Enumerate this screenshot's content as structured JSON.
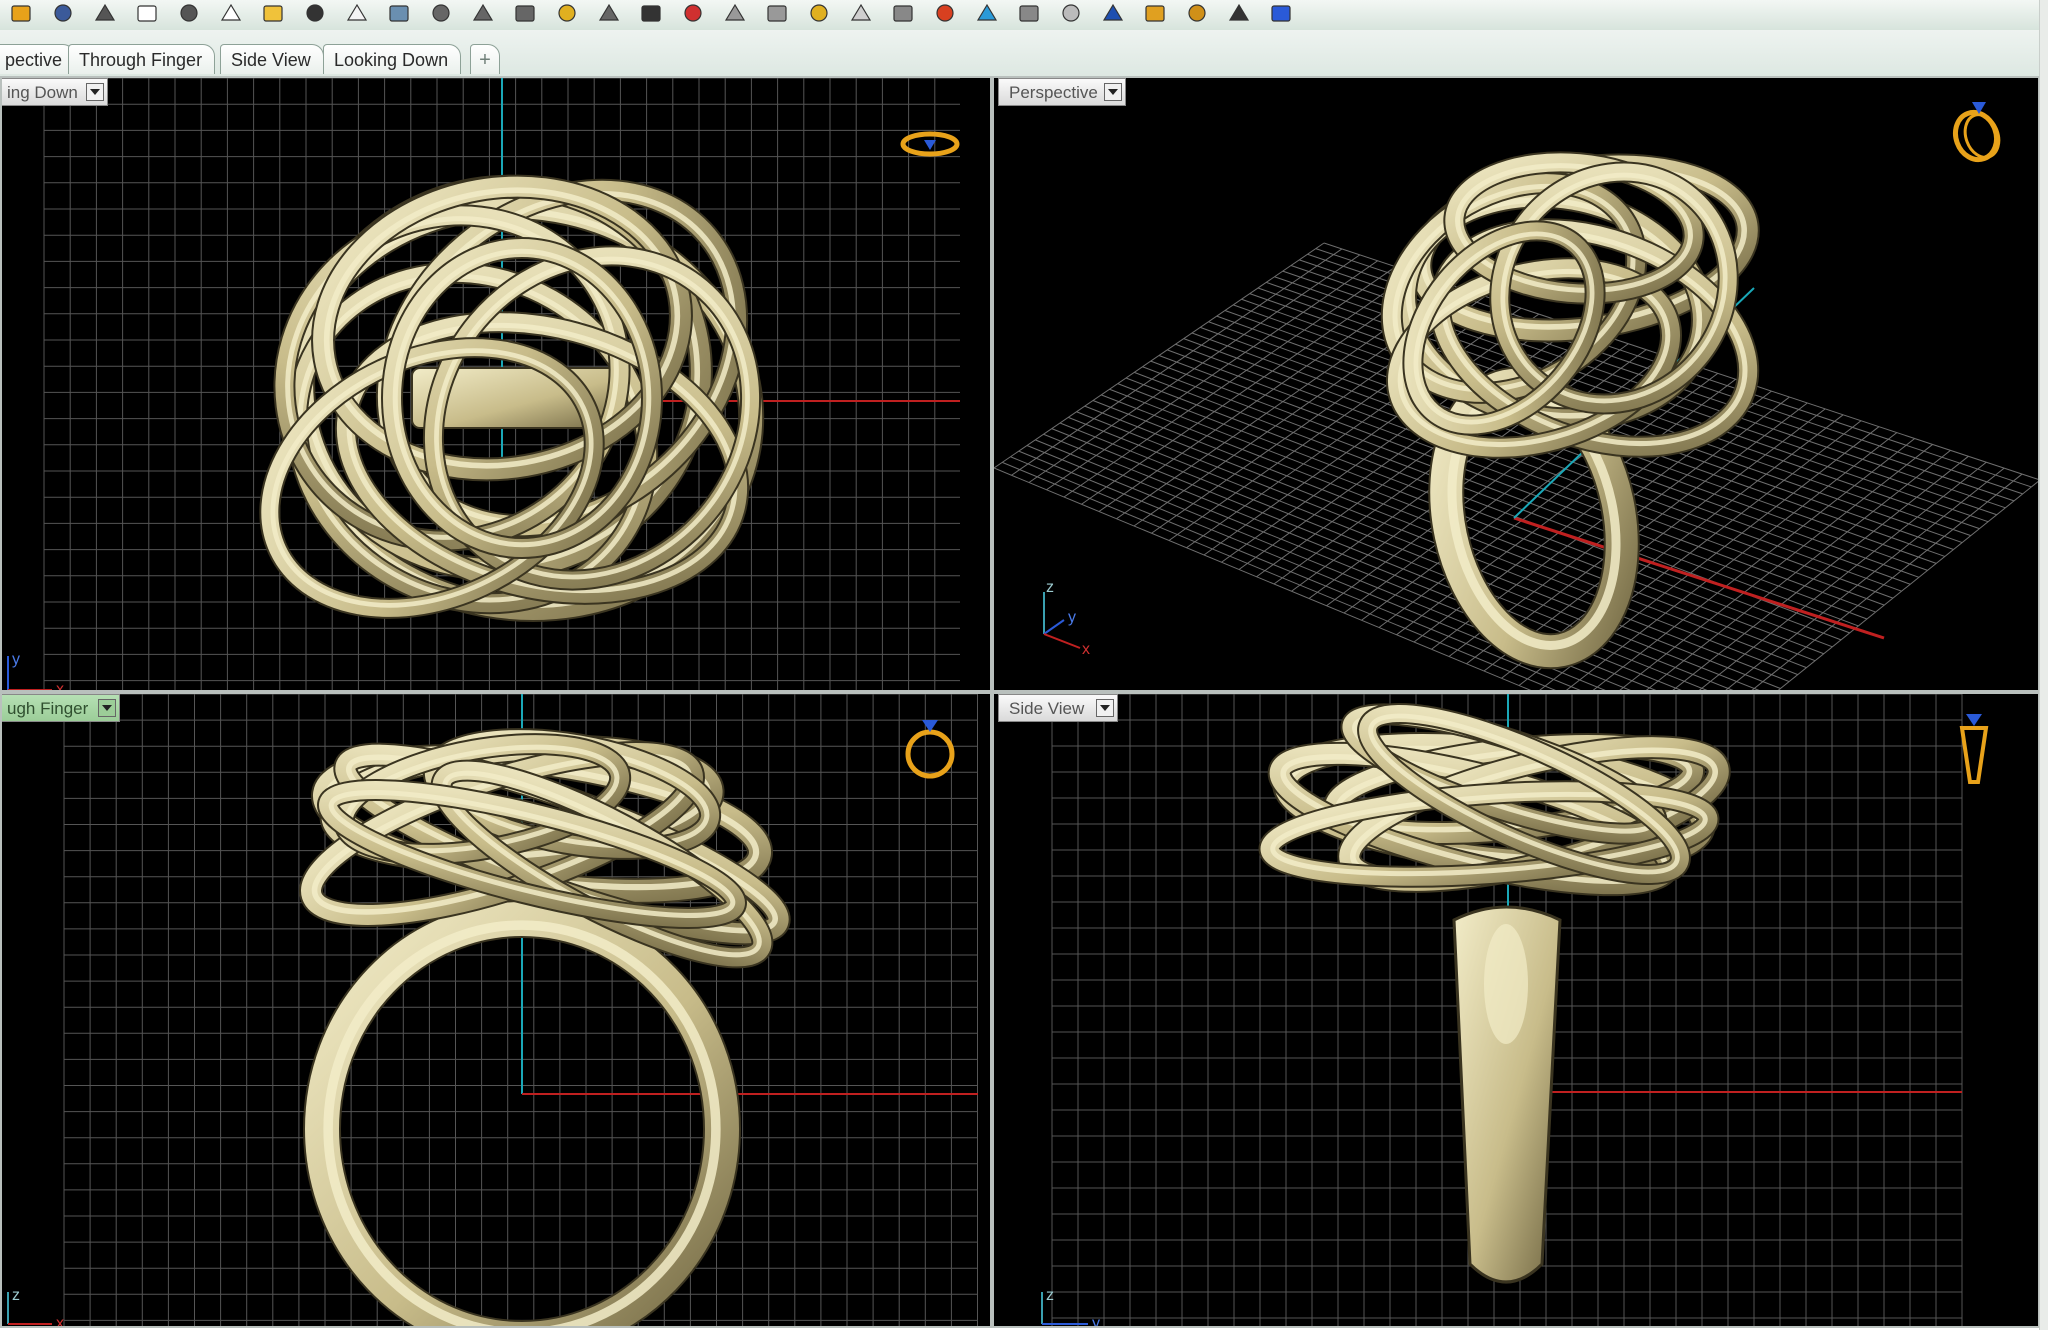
{
  "toolbar": {
    "buttons": [
      {
        "name": "open-icon",
        "color": "#e8a21a"
      },
      {
        "name": "save-icon",
        "color": "#3b5a9a"
      },
      {
        "name": "print-icon",
        "color": "#555555"
      },
      {
        "name": "new-page-icon",
        "color": "#ffffff"
      },
      {
        "name": "cut-icon",
        "color": "#555555"
      },
      {
        "name": "copy-icon",
        "color": "#ffffff"
      },
      {
        "name": "paste-icon",
        "color": "#f0c23a"
      },
      {
        "name": "undo-icon",
        "color": "#333333"
      },
      {
        "name": "pan-hand-icon",
        "color": "#f4f4f4"
      },
      {
        "name": "rotate-view-icon",
        "color": "#6a8fb0"
      },
      {
        "name": "zoom-dynamic-icon",
        "color": "#666666"
      },
      {
        "name": "zoom-window-icon",
        "color": "#666666"
      },
      {
        "name": "zoom-extents-icon",
        "color": "#666666"
      },
      {
        "name": "zoom-selected-icon",
        "color": "#e0b020"
      },
      {
        "name": "zoom-target-icon",
        "color": "#666666"
      },
      {
        "name": "four-viewports-icon",
        "color": "#333333"
      },
      {
        "name": "car-icon",
        "color": "#d03030"
      },
      {
        "name": "construction-plane-icon",
        "color": "#999999"
      },
      {
        "name": "circle-snap-icon",
        "color": "#999999"
      },
      {
        "name": "points-icon",
        "color": "#e0b020"
      },
      {
        "name": "lightbulb-icon",
        "color": "#cfcfcf"
      },
      {
        "name": "lock-icon",
        "color": "#888888"
      },
      {
        "name": "layers-icon",
        "color": "#d84020"
      },
      {
        "name": "color-wheel-icon",
        "color": "#2a9ad8"
      },
      {
        "name": "wireframe-sphere-icon",
        "color": "#888888"
      },
      {
        "name": "shaded-sphere-icon",
        "color": "#bbbbbb"
      },
      {
        "name": "render-sphere-icon",
        "color": "#1e4fb0"
      },
      {
        "name": "pencil-icon",
        "color": "#e0a020"
      },
      {
        "name": "settings-gear-icon",
        "color": "#d09018"
      },
      {
        "name": "grid-snap-icon",
        "color": "#333333"
      },
      {
        "name": "help-icon",
        "color": "#2a5ad8"
      }
    ]
  },
  "tabs": [
    {
      "label": "pective",
      "active": false
    },
    {
      "label": "Through Finger",
      "active": true
    },
    {
      "label": "Side View",
      "active": false
    },
    {
      "label": "Looking Down",
      "active": false
    }
  ],
  "tab_add_label": "+",
  "viewports": {
    "top_left": {
      "label": "ing Down",
      "gumball": "flat-ring-icon"
    },
    "top_right": {
      "label": "Perspective",
      "gumball": "perspective-ring-icon"
    },
    "bottom_left": {
      "label": "ugh Finger",
      "gumball": "front-ring-icon"
    },
    "bottom_right": {
      "label": "Side View",
      "gumball": "side-ring-icon"
    }
  },
  "axes": {
    "top_left": {
      "v": "y",
      "h": "x"
    },
    "top_right": {
      "v": "z",
      "d": "y",
      "h": "x"
    },
    "bottom_left": {
      "v": "z",
      "h": "x"
    },
    "bottom_right": {
      "v": "z",
      "h": "y"
    }
  },
  "colors": {
    "grid": "#555555",
    "axis_red": "#c02020",
    "axis_cyan": "#1aa8b8",
    "gold_light": "#f2ecc8",
    "gold_mid": "#c8bc8a",
    "gold_dark": "#6e6440",
    "seam_green": "#2a8a6a",
    "gumball_orange": "#e8a21a",
    "gumball_blue": "#2a5ad8"
  }
}
